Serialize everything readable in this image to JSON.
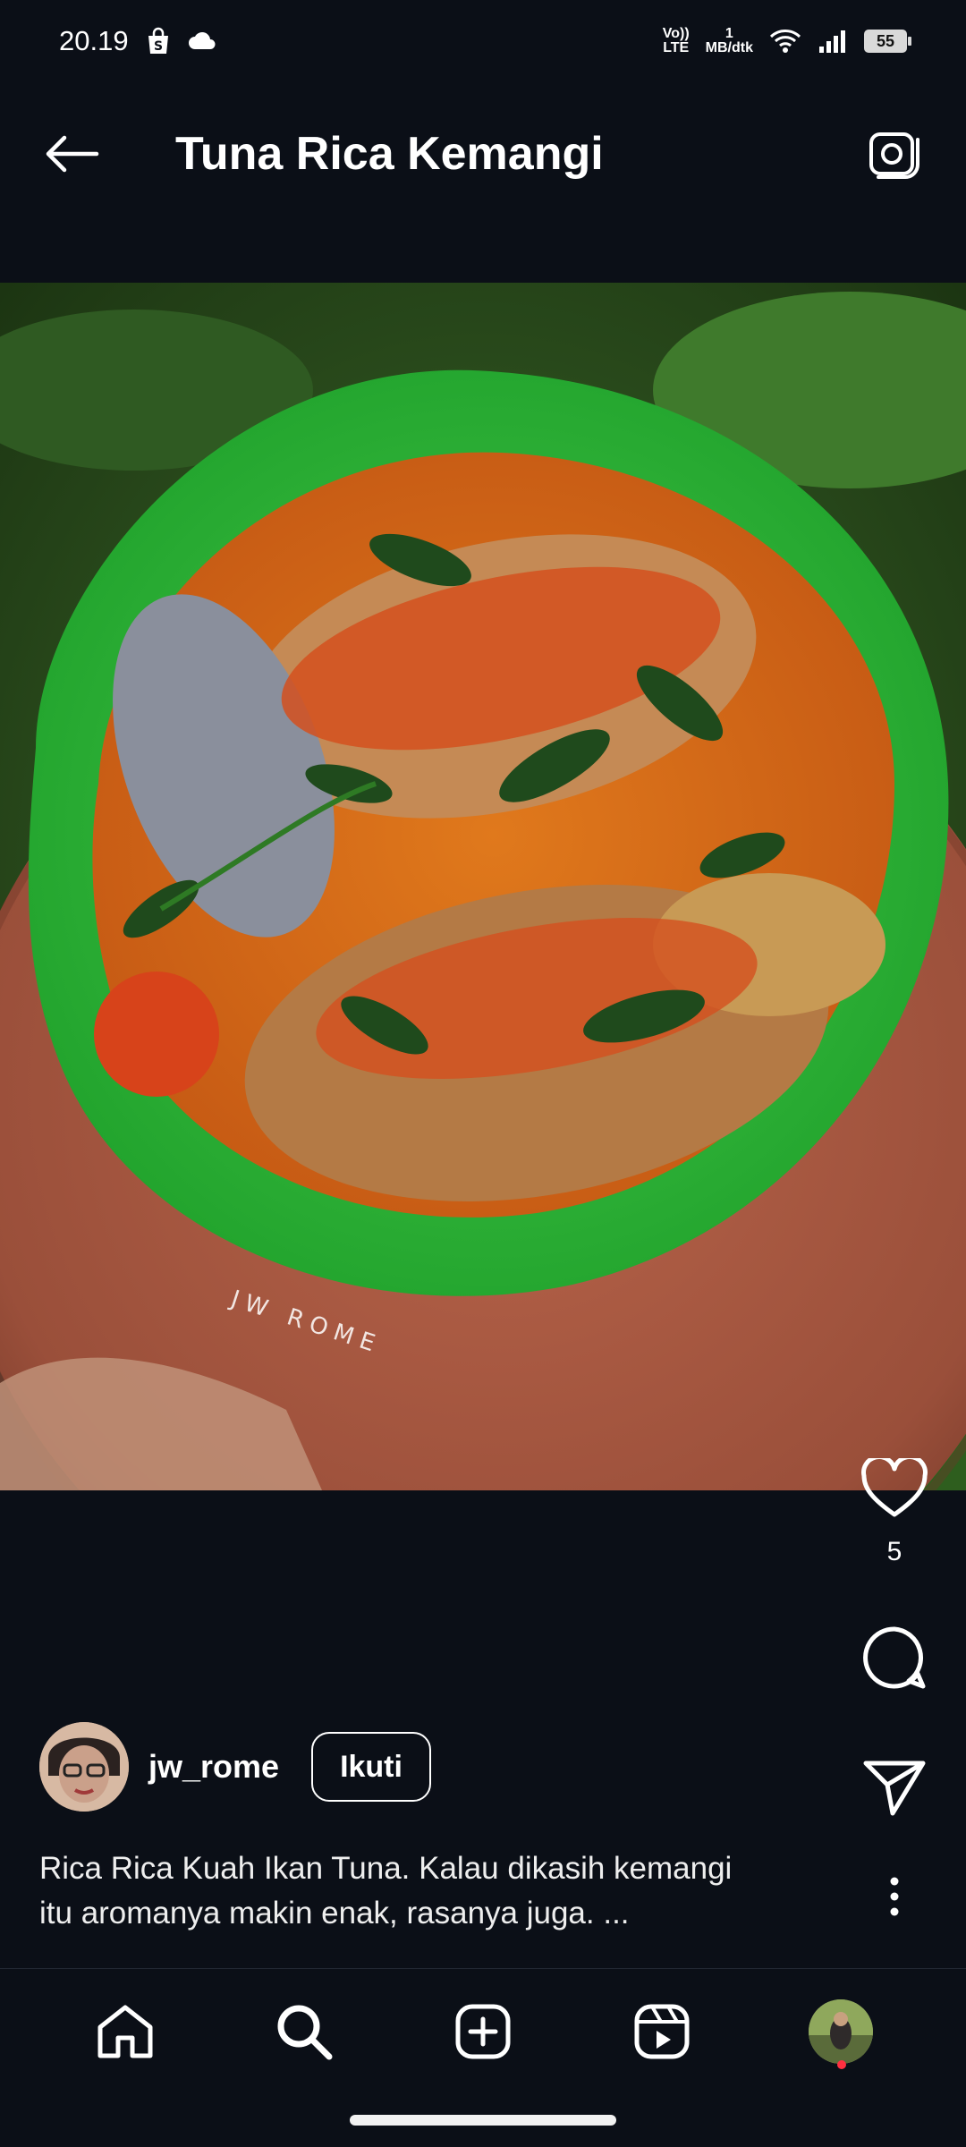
{
  "status_bar": {
    "time": "20.19",
    "network_type": "LTE",
    "network_vo": "Vo))",
    "speed_value": "1",
    "speed_unit": "MB/dtk",
    "battery": "55"
  },
  "header": {
    "title": "Tuna Rica Kemangi"
  },
  "post": {
    "image_watermark": "JW ROME",
    "likes": "5",
    "author": "jw_rome",
    "follow_label": "Ikuti",
    "caption_line1": "Rica Rica Kuah Ikan Tuna. Kalau dikasih kemangi",
    "caption_line2": "itu aromanya makin enak, rasanya juga. ..."
  },
  "icons": {
    "back": "arrow-left",
    "camera": "camera",
    "like": "heart-outline",
    "comment": "chat-bubble",
    "share": "paper-plane",
    "more": "vertical-ellipsis"
  },
  "bottom_nav": [
    "home",
    "search",
    "create",
    "reels",
    "profile"
  ],
  "colors": {
    "background": "#0b0f17",
    "notification_dot": "#ff3040"
  }
}
